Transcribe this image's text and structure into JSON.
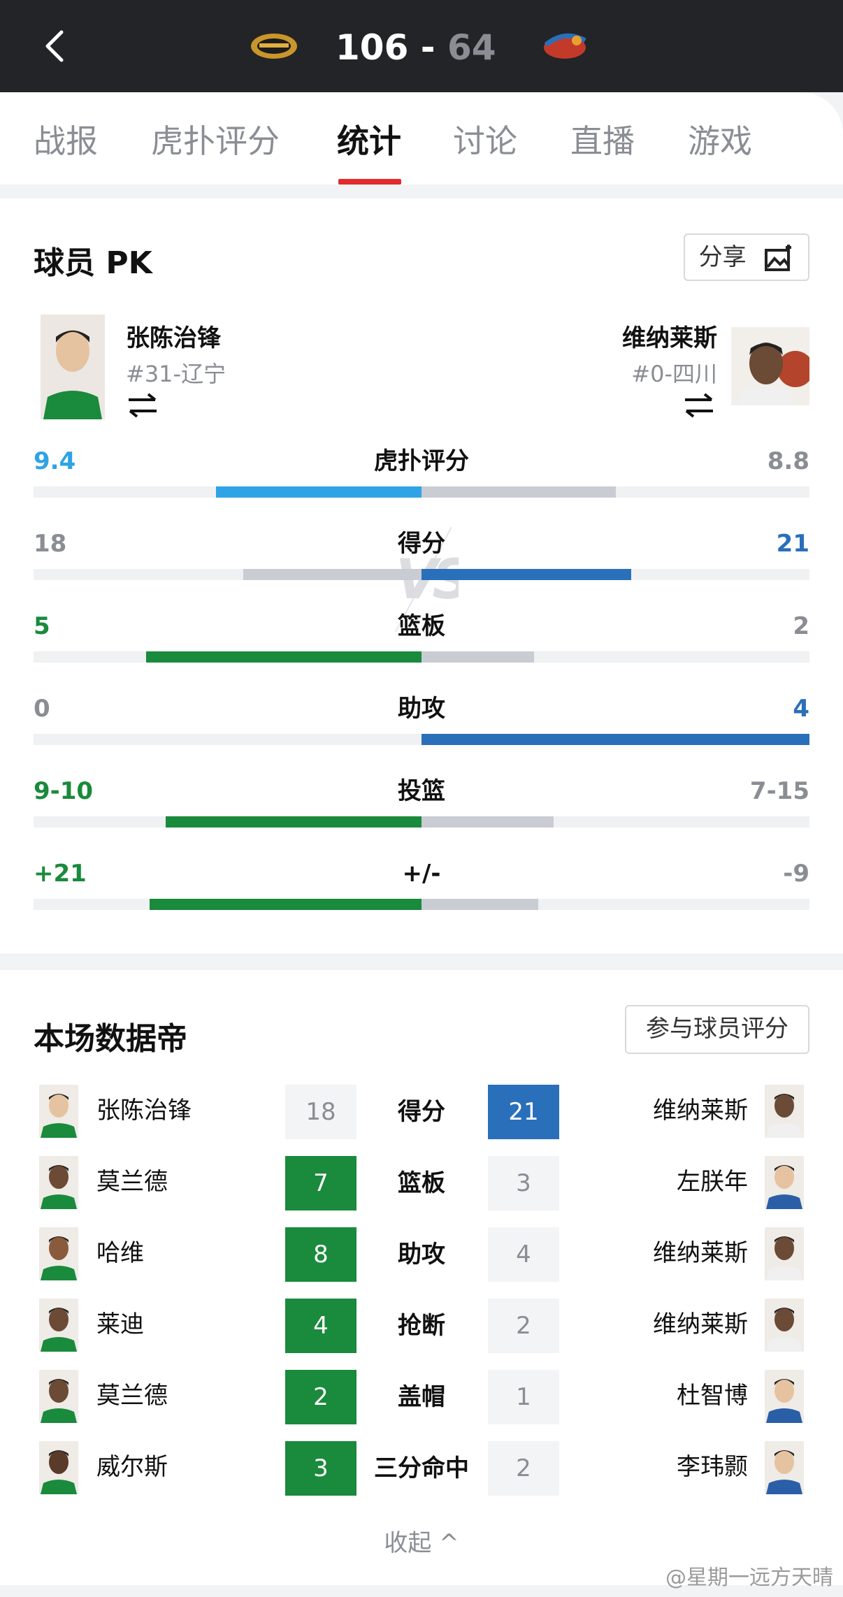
{
  "header": {
    "back_icon": "chevron-left-icon",
    "home_score": "106",
    "separator": "-",
    "away_score": "64",
    "home_logo": "team-logo",
    "away_logo": "team-logo",
    "colors": {
      "bg": "#232427",
      "away_score": "#8a8d93"
    }
  },
  "tabs": [
    {
      "label": "战报"
    },
    {
      "label": "虎扑评分"
    },
    {
      "label": "统计"
    },
    {
      "label": "讨论"
    },
    {
      "label": "直播"
    },
    {
      "label": "游戏"
    }
  ],
  "active_tab": "统计",
  "pk": {
    "title": "球员 PK",
    "share_label": "分享",
    "share_icon": "image-share-icon",
    "vs_text": "VS",
    "swap_icon": "swap-arrows-icon",
    "left_player": {
      "name": "张陈治锋",
      "number": "#31-辽宁"
    },
    "right_player": {
      "name": "维纳莱斯",
      "number": "#0-四川"
    },
    "stats": [
      {
        "label": "虎扑评分",
        "left": "9.4",
        "right": "8.8",
        "left_frac": 0.53,
        "right_frac": 0.5,
        "winner": "left",
        "left_color": "#2fa3e6",
        "right_color": "#c9ccd3",
        "left_text_color": "#2fa3e6",
        "right_text_color": "#8a8d93"
      },
      {
        "label": "得分",
        "left": "18",
        "right": "21",
        "left_frac": 0.46,
        "right_frac": 0.54,
        "winner": "right",
        "left_color": "#c9ccd3",
        "right_color": "#2a6fba",
        "left_text_color": "#8a8d93",
        "right_text_color": "#2a6fba"
      },
      {
        "label": "篮板",
        "left": "5",
        "right": "2",
        "left_frac": 0.71,
        "right_frac": 0.29,
        "winner": "left",
        "left_color": "#1a8a3c",
        "right_color": "#c9ccd3",
        "left_text_color": "#1a8a3c",
        "right_text_color": "#8a8d93"
      },
      {
        "label": "助攻",
        "left": "0",
        "right": "4",
        "left_frac": 0.0,
        "right_frac": 1.0,
        "winner": "right",
        "left_color": "#c9ccd3",
        "right_color": "#2a6fba",
        "left_text_color": "#8a8d93",
        "right_text_color": "#2a6fba"
      },
      {
        "label": "投篮",
        "left": "9-10",
        "right": "7-15",
        "left_frac": 0.66,
        "right_frac": 0.34,
        "winner": "left",
        "left_color": "#1a8a3c",
        "right_color": "#c9ccd3",
        "left_text_color": "#1a8a3c",
        "right_text_color": "#8a8d93"
      },
      {
        "label": "+/-",
        "left": "+21",
        "right": "-9",
        "left_frac": 0.7,
        "right_frac": 0.3,
        "winner": "left",
        "left_color": "#1a8a3c",
        "right_color": "#c9ccd3",
        "left_text_color": "#1a8a3c",
        "right_text_color": "#8a8d93"
      }
    ]
  },
  "leaders": {
    "title": "本场数据帝",
    "rate_button": "参与球员评分",
    "rows": [
      {
        "left_name": "张陈治锋",
        "left_value": "18",
        "label": "得分",
        "right_value": "21",
        "right_name": "维纳莱斯",
        "left_style": "grey",
        "right_style": "blue"
      },
      {
        "left_name": "莫兰德",
        "left_value": "7",
        "label": "篮板",
        "right_value": "3",
        "right_name": "左朕年",
        "left_style": "green",
        "right_style": "grey"
      },
      {
        "left_name": "哈维",
        "left_value": "8",
        "label": "助攻",
        "right_value": "4",
        "right_name": "维纳莱斯",
        "left_style": "green",
        "right_style": "grey"
      },
      {
        "left_name": "莱迪",
        "left_value": "4",
        "label": "抢断",
        "right_value": "2",
        "right_name": "维纳莱斯",
        "left_style": "green",
        "right_style": "grey"
      },
      {
        "left_name": "莫兰德",
        "left_value": "2",
        "label": "盖帽",
        "right_value": "1",
        "right_name": "杜智博",
        "left_style": "green",
        "right_style": "grey"
      },
      {
        "left_name": "威尔斯",
        "left_value": "3",
        "label": "三分命中",
        "right_value": "2",
        "right_name": "李玮颢",
        "left_style": "green",
        "right_style": "grey"
      }
    ],
    "collapse_label": "收起 ^"
  },
  "watermark": "@星期一远方天晴"
}
